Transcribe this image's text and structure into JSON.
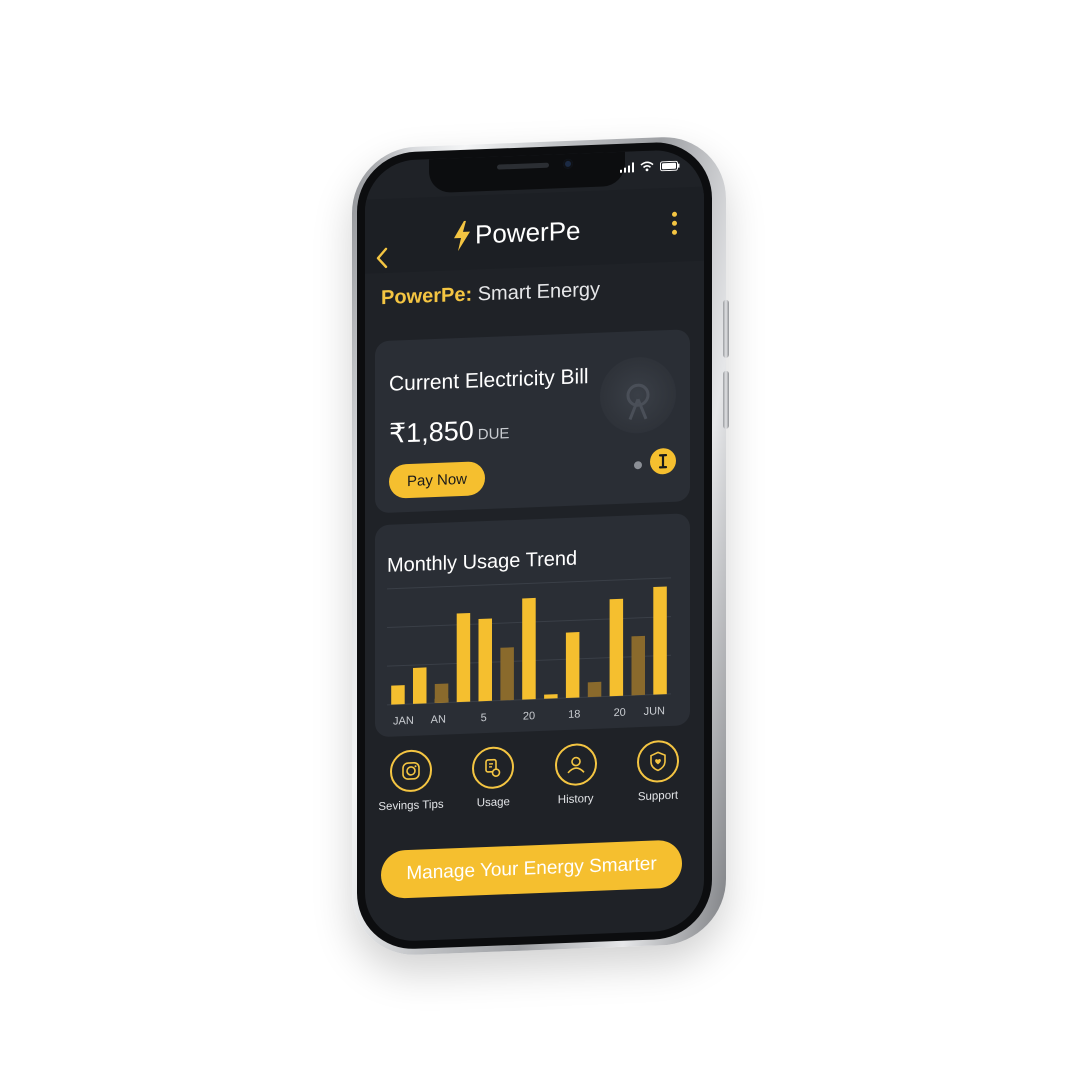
{
  "header": {
    "brand_name": "PowerPe",
    "subtitle_accent": "PowerPe:",
    "subtitle_rest": " Smart Energy"
  },
  "bill": {
    "title": "Current Electricity Bill",
    "amount": "₹1,850",
    "due_label": "DUE",
    "pay_label": "Pay Now"
  },
  "usage_chart": {
    "title": "Monthly Usage Trend"
  },
  "chart_data": {
    "type": "bar",
    "title": "Monthly Usage Trend",
    "tick_labels": [
      "JAN",
      "AN",
      "5",
      "20",
      "18",
      "20",
      "JUN"
    ],
    "series": [
      {
        "values": [
          18,
          34,
          4,
          84,
          78,
          0,
          96,
          4,
          62,
          0,
          92,
          0,
          102
        ]
      },
      {
        "values": [
          0,
          0,
          18,
          0,
          0,
          50,
          0,
          0,
          0,
          14,
          0,
          56,
          0
        ]
      }
    ],
    "ylim": [
      0,
      110
    ],
    "grid": true,
    "colors": [
      "#f5bf2f",
      "#8a6a2c"
    ]
  },
  "quick_actions": [
    {
      "label": "Sevings Tips",
      "icon": "savings-icon"
    },
    {
      "label": "Usage",
      "icon": "usage-icon"
    },
    {
      "label": "History",
      "icon": "history-icon"
    },
    {
      "label": "Support",
      "icon": "support-icon"
    }
  ],
  "cta": {
    "label": "Manage Your Energy Smarter"
  },
  "colors": {
    "accent": "#f5bf2f",
    "background": "#1f2227",
    "card": "#2a2e35"
  }
}
